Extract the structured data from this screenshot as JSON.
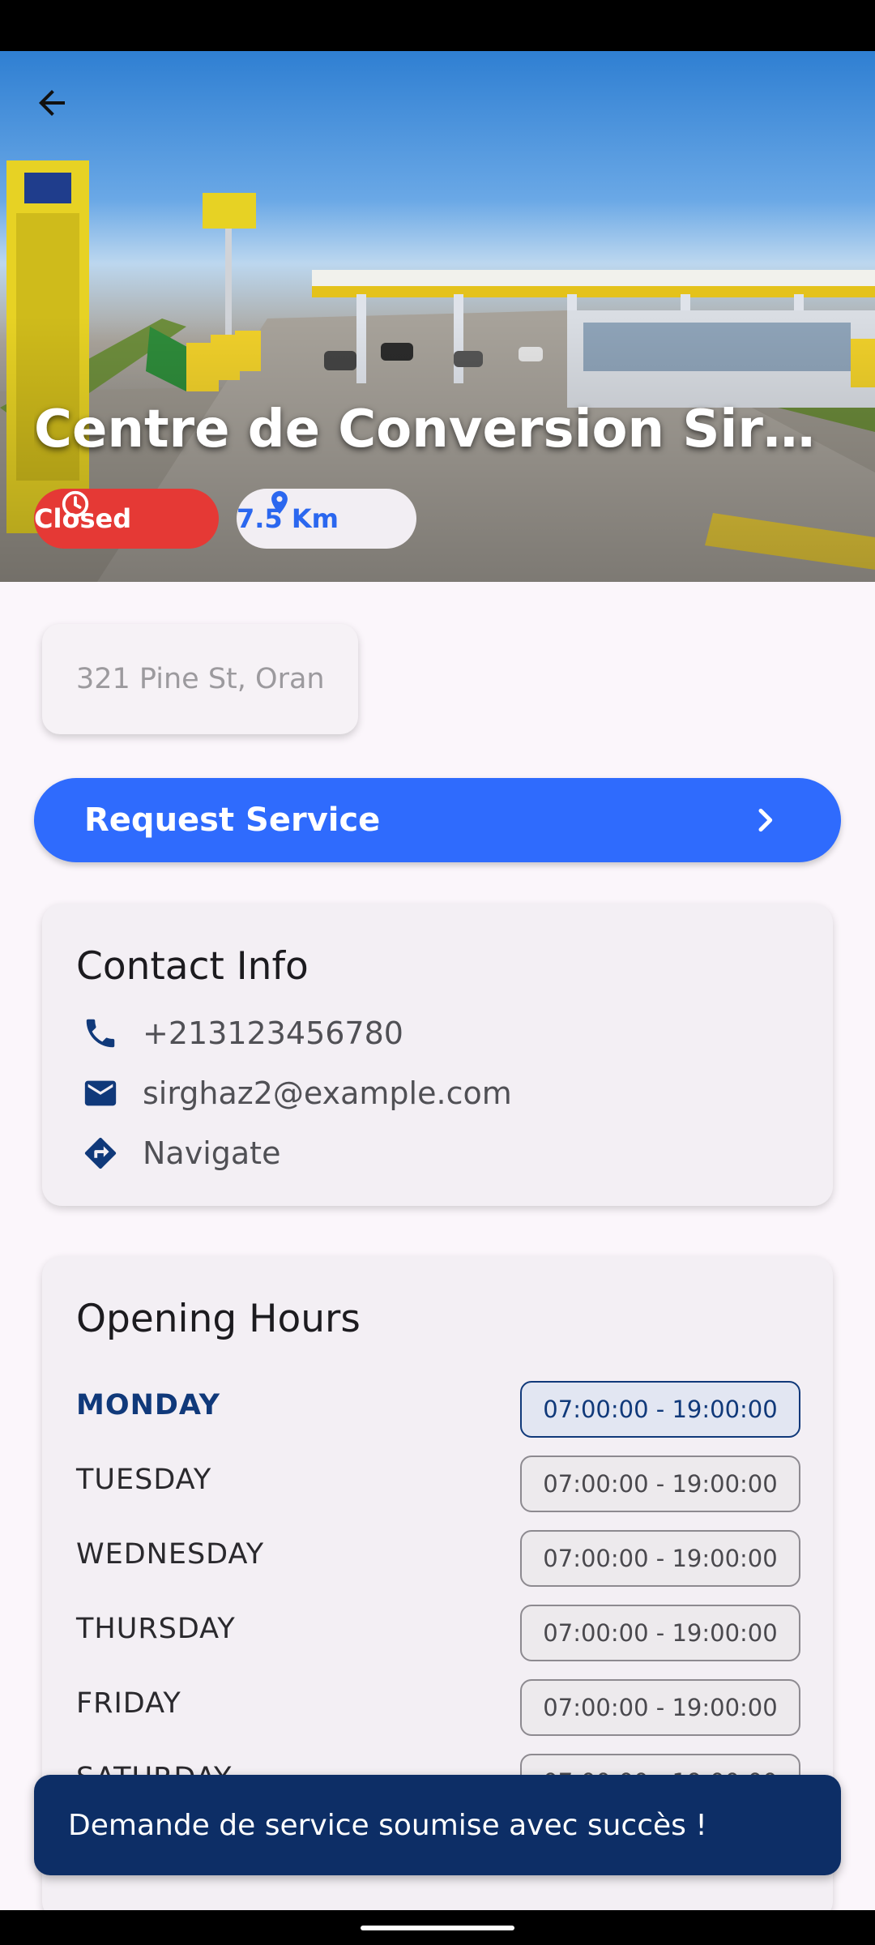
{
  "station": {
    "name": "Centre de Conversion Sirghaz...",
    "status": "Closed",
    "distance": "7.5 Km",
    "address": "321 Pine St, Oran"
  },
  "actions": {
    "request_service": "Request Service"
  },
  "contact": {
    "title": "Contact Info",
    "phone": "+213123456780",
    "email": "sirghaz2@example.com",
    "navigate": "Navigate"
  },
  "hours": {
    "title": "Opening Hours",
    "days": [
      {
        "day": "MONDAY",
        "hours": "07:00:00 - 19:00:00"
      },
      {
        "day": "TUESDAY",
        "hours": "07:00:00 - 19:00:00"
      },
      {
        "day": "WEDNESDAY",
        "hours": "07:00:00 - 19:00:00"
      },
      {
        "day": "THURSDAY",
        "hours": "07:00:00 - 19:00:00"
      },
      {
        "day": "FRIDAY",
        "hours": "07:00:00 - 19:00:00"
      },
      {
        "day": "SATURDAY",
        "hours": "07:00:00 - 19:00:00"
      }
    ]
  },
  "snackbar": {
    "message": "Demande de service soumise avec succès !"
  },
  "colors": {
    "primary": "#2f6bfd",
    "closed": "#e53935",
    "navy": "#0d2e66",
    "today": "#10397a"
  },
  "icons": {
    "back": "arrow-back-icon",
    "clock": "clock-icon",
    "location": "location-pin-icon",
    "chevron": "chevron-right-icon",
    "phone": "phone-icon",
    "email": "mail-icon",
    "navigate": "directions-icon"
  }
}
